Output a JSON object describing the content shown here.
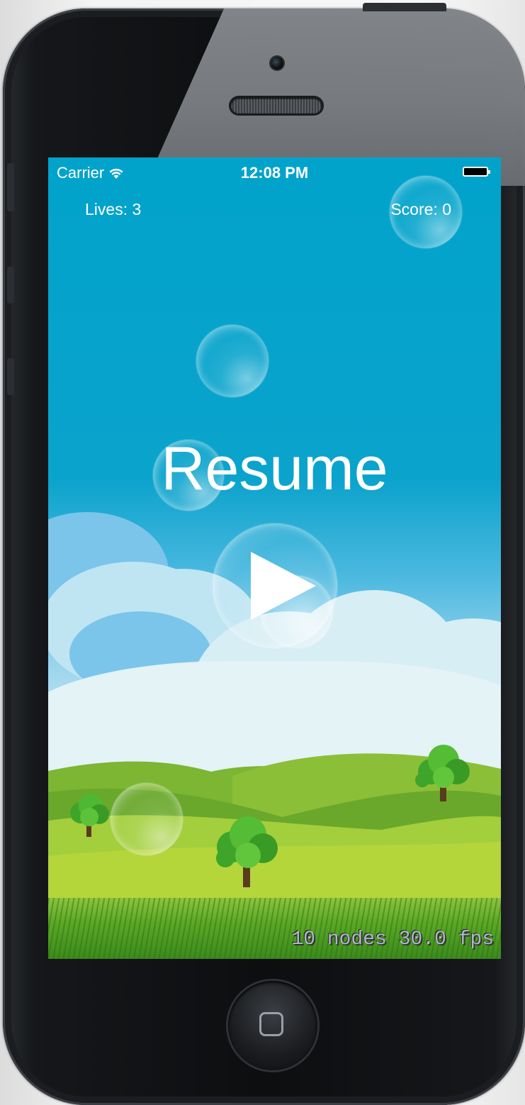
{
  "status_bar": {
    "carrier": "Carrier",
    "wifi_icon": "wifi-icon",
    "time": "12:08 PM",
    "battery_icon": "battery-icon"
  },
  "hud": {
    "lives": "Lives: 3",
    "score": "Score: 0"
  },
  "pause_menu": {
    "title": "Resume",
    "play_icon": "play-icon"
  },
  "debug": {
    "stats": "10 nodes 30.0 fps"
  },
  "colors": {
    "sky": "#01a3cb",
    "text": "#ffffff",
    "grass": "#5da826"
  }
}
